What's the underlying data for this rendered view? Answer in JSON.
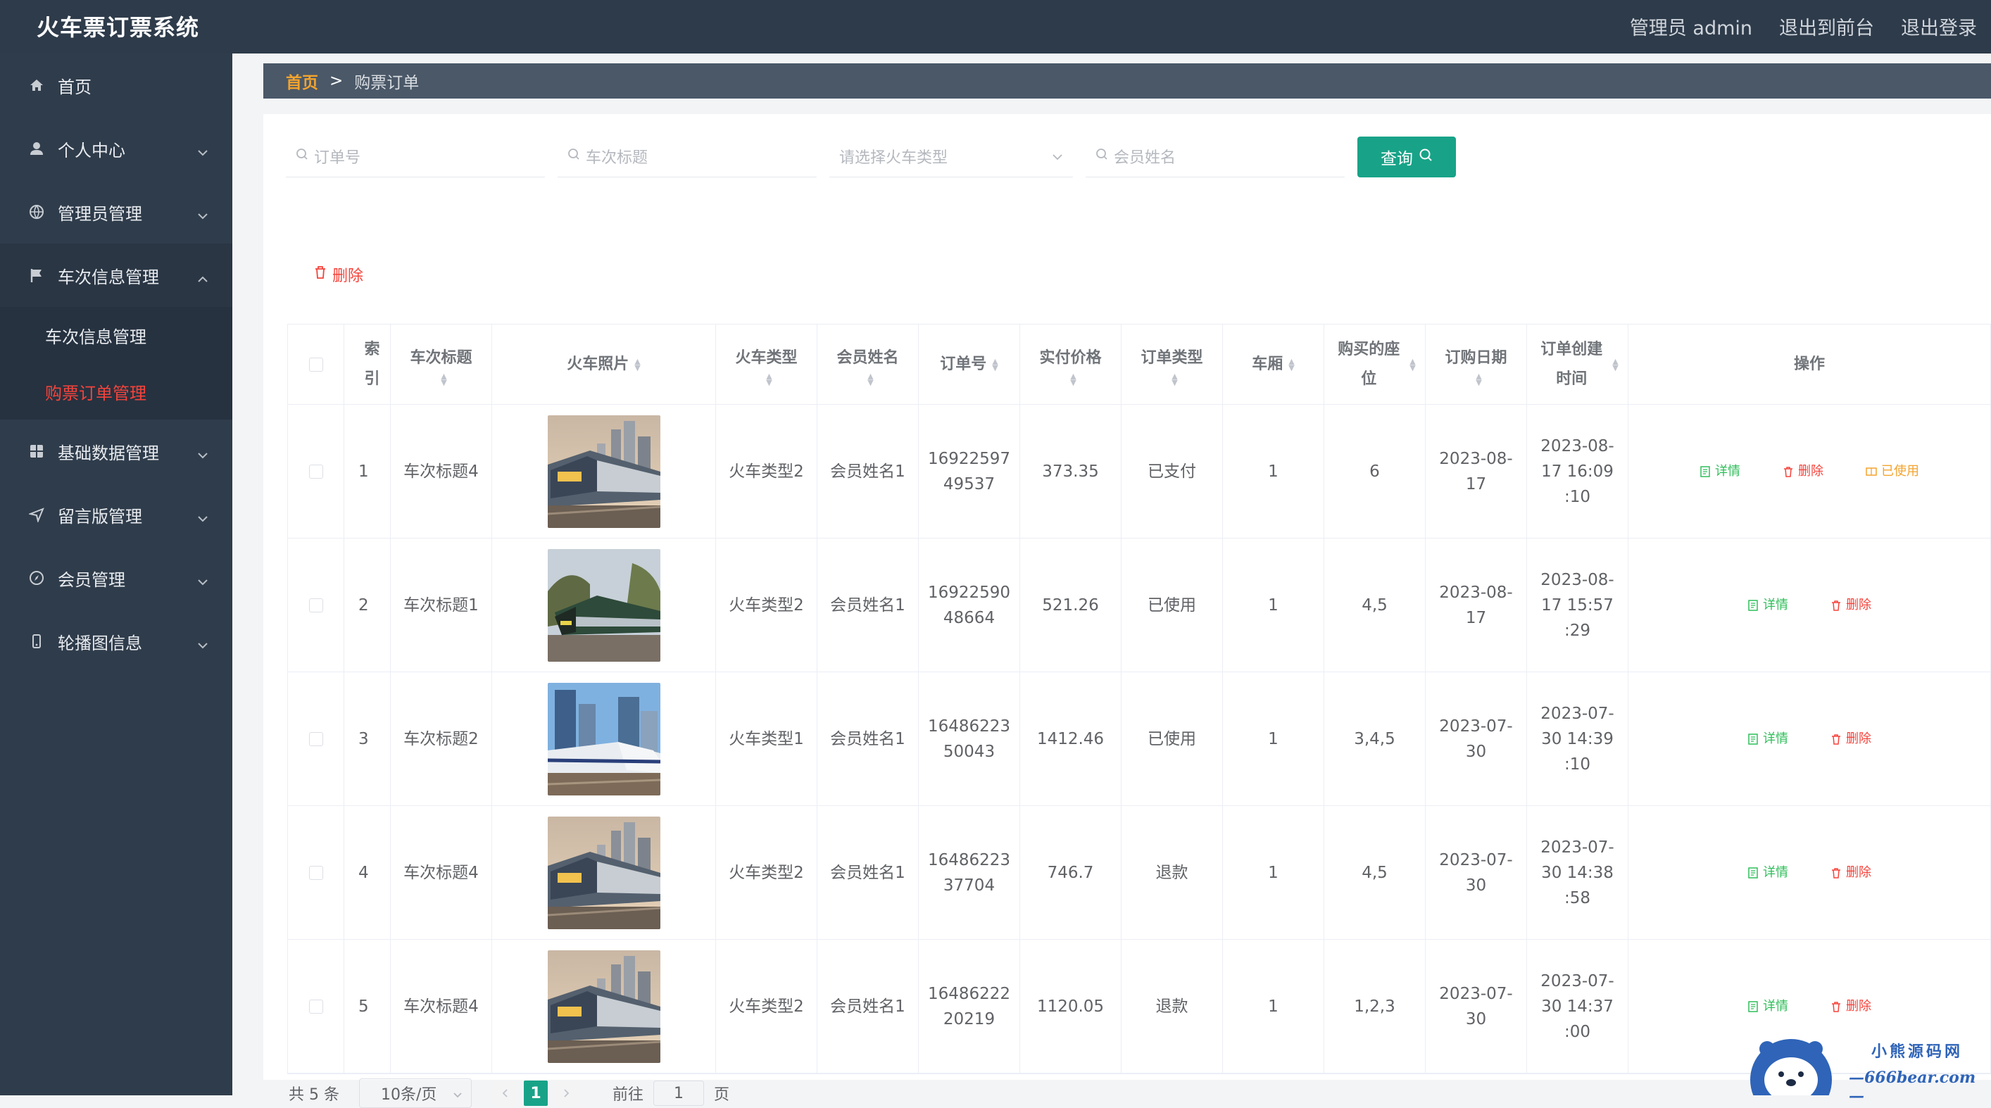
{
  "app": {
    "title": "火车票订票系统"
  },
  "topbar": {
    "admin_label": "管理员 admin",
    "front_label": "退出到前台",
    "logout_label": "退出登录"
  },
  "sidebar": {
    "items": [
      {
        "label": "首页",
        "icon": "home-icon"
      },
      {
        "label": "个人中心",
        "icon": "user-icon"
      },
      {
        "label": "管理员管理",
        "icon": "globe-icon"
      },
      {
        "label": "车次信息管理",
        "icon": "flag-icon"
      },
      {
        "label": "基础数据管理",
        "icon": "grid-icon"
      },
      {
        "label": "留言版管理",
        "icon": "send-icon"
      },
      {
        "label": "会员管理",
        "icon": "compass-icon"
      },
      {
        "label": "轮播图信息",
        "icon": "phone-icon"
      }
    ],
    "sub_items": [
      {
        "label": "车次信息管理"
      },
      {
        "label": "购票订单管理"
      }
    ]
  },
  "breadcrumb": {
    "home": "首页",
    "separator": ">",
    "current": "购票订单"
  },
  "search": {
    "order_no_placeholder": "订单号",
    "title_placeholder": "车次标题",
    "type_placeholder": "请选择火车类型",
    "member_placeholder": "会员姓名",
    "query_label": "查询"
  },
  "actions": {
    "delete_label": "删除"
  },
  "table": {
    "headers": [
      "索引",
      "车次标题",
      "火车照片",
      "火车类型",
      "会员姓名",
      "订单号",
      "实付价格",
      "订单类型",
      "车厢",
      "购买的座位",
      "订购日期",
      "订单创建时间",
      "操作"
    ],
    "rows": [
      {
        "index": "1",
        "title": "车次标题4",
        "photo": "train-a",
        "type": "火车类型2",
        "member": "会员姓名1",
        "order_no": "1692259749537",
        "price": "373.35",
        "order_type": "已支付",
        "carriage": "1",
        "seats": "6",
        "date": "2023-08-17",
        "created": "2023-08-17 16:09:10",
        "ops": [
          "详情",
          "删除",
          "已使用"
        ]
      },
      {
        "index": "2",
        "title": "车次标题1",
        "photo": "train-b",
        "type": "火车类型2",
        "member": "会员姓名1",
        "order_no": "1692259048664",
        "price": "521.26",
        "order_type": "已使用",
        "carriage": "1",
        "seats": "4,5",
        "date": "2023-08-17",
        "created": "2023-08-17 15:57:29",
        "ops": [
          "详情",
          "删除"
        ]
      },
      {
        "index": "3",
        "title": "车次标题2",
        "photo": "train-c",
        "type": "火车类型1",
        "member": "会员姓名1",
        "order_no": "1648622350043",
        "price": "1412.46",
        "order_type": "已使用",
        "carriage": "1",
        "seats": "3,4,5",
        "date": "2023-07-30",
        "created": "2023-07-30 14:39:10",
        "ops": [
          "详情",
          "删除"
        ]
      },
      {
        "index": "4",
        "title": "车次标题4",
        "photo": "train-a",
        "type": "火车类型2",
        "member": "会员姓名1",
        "order_no": "1648622337704",
        "price": "746.7",
        "order_type": "退款",
        "carriage": "1",
        "seats": "4,5",
        "date": "2023-07-30",
        "created": "2023-07-30 14:38:58",
        "ops": [
          "详情",
          "删除"
        ]
      },
      {
        "index": "5",
        "title": "车次标题4",
        "photo": "train-a",
        "type": "火车类型2",
        "member": "会员姓名1",
        "order_no": "1648622220219",
        "price": "1120.05",
        "order_type": "退款",
        "carriage": "1",
        "seats": "1,2,3",
        "date": "2023-07-30",
        "created": "2023-07-30 14:37:00",
        "ops": [
          "详情",
          "删除"
        ]
      }
    ]
  },
  "pagination": {
    "total_label": "共 5 条",
    "page_size": "10条/页",
    "current_page": "1",
    "goto_label": "前往",
    "goto_value": "1",
    "page_unit": "页"
  },
  "watermark": {
    "line1": "小熊源码网",
    "line2": "—666bear.com—"
  }
}
